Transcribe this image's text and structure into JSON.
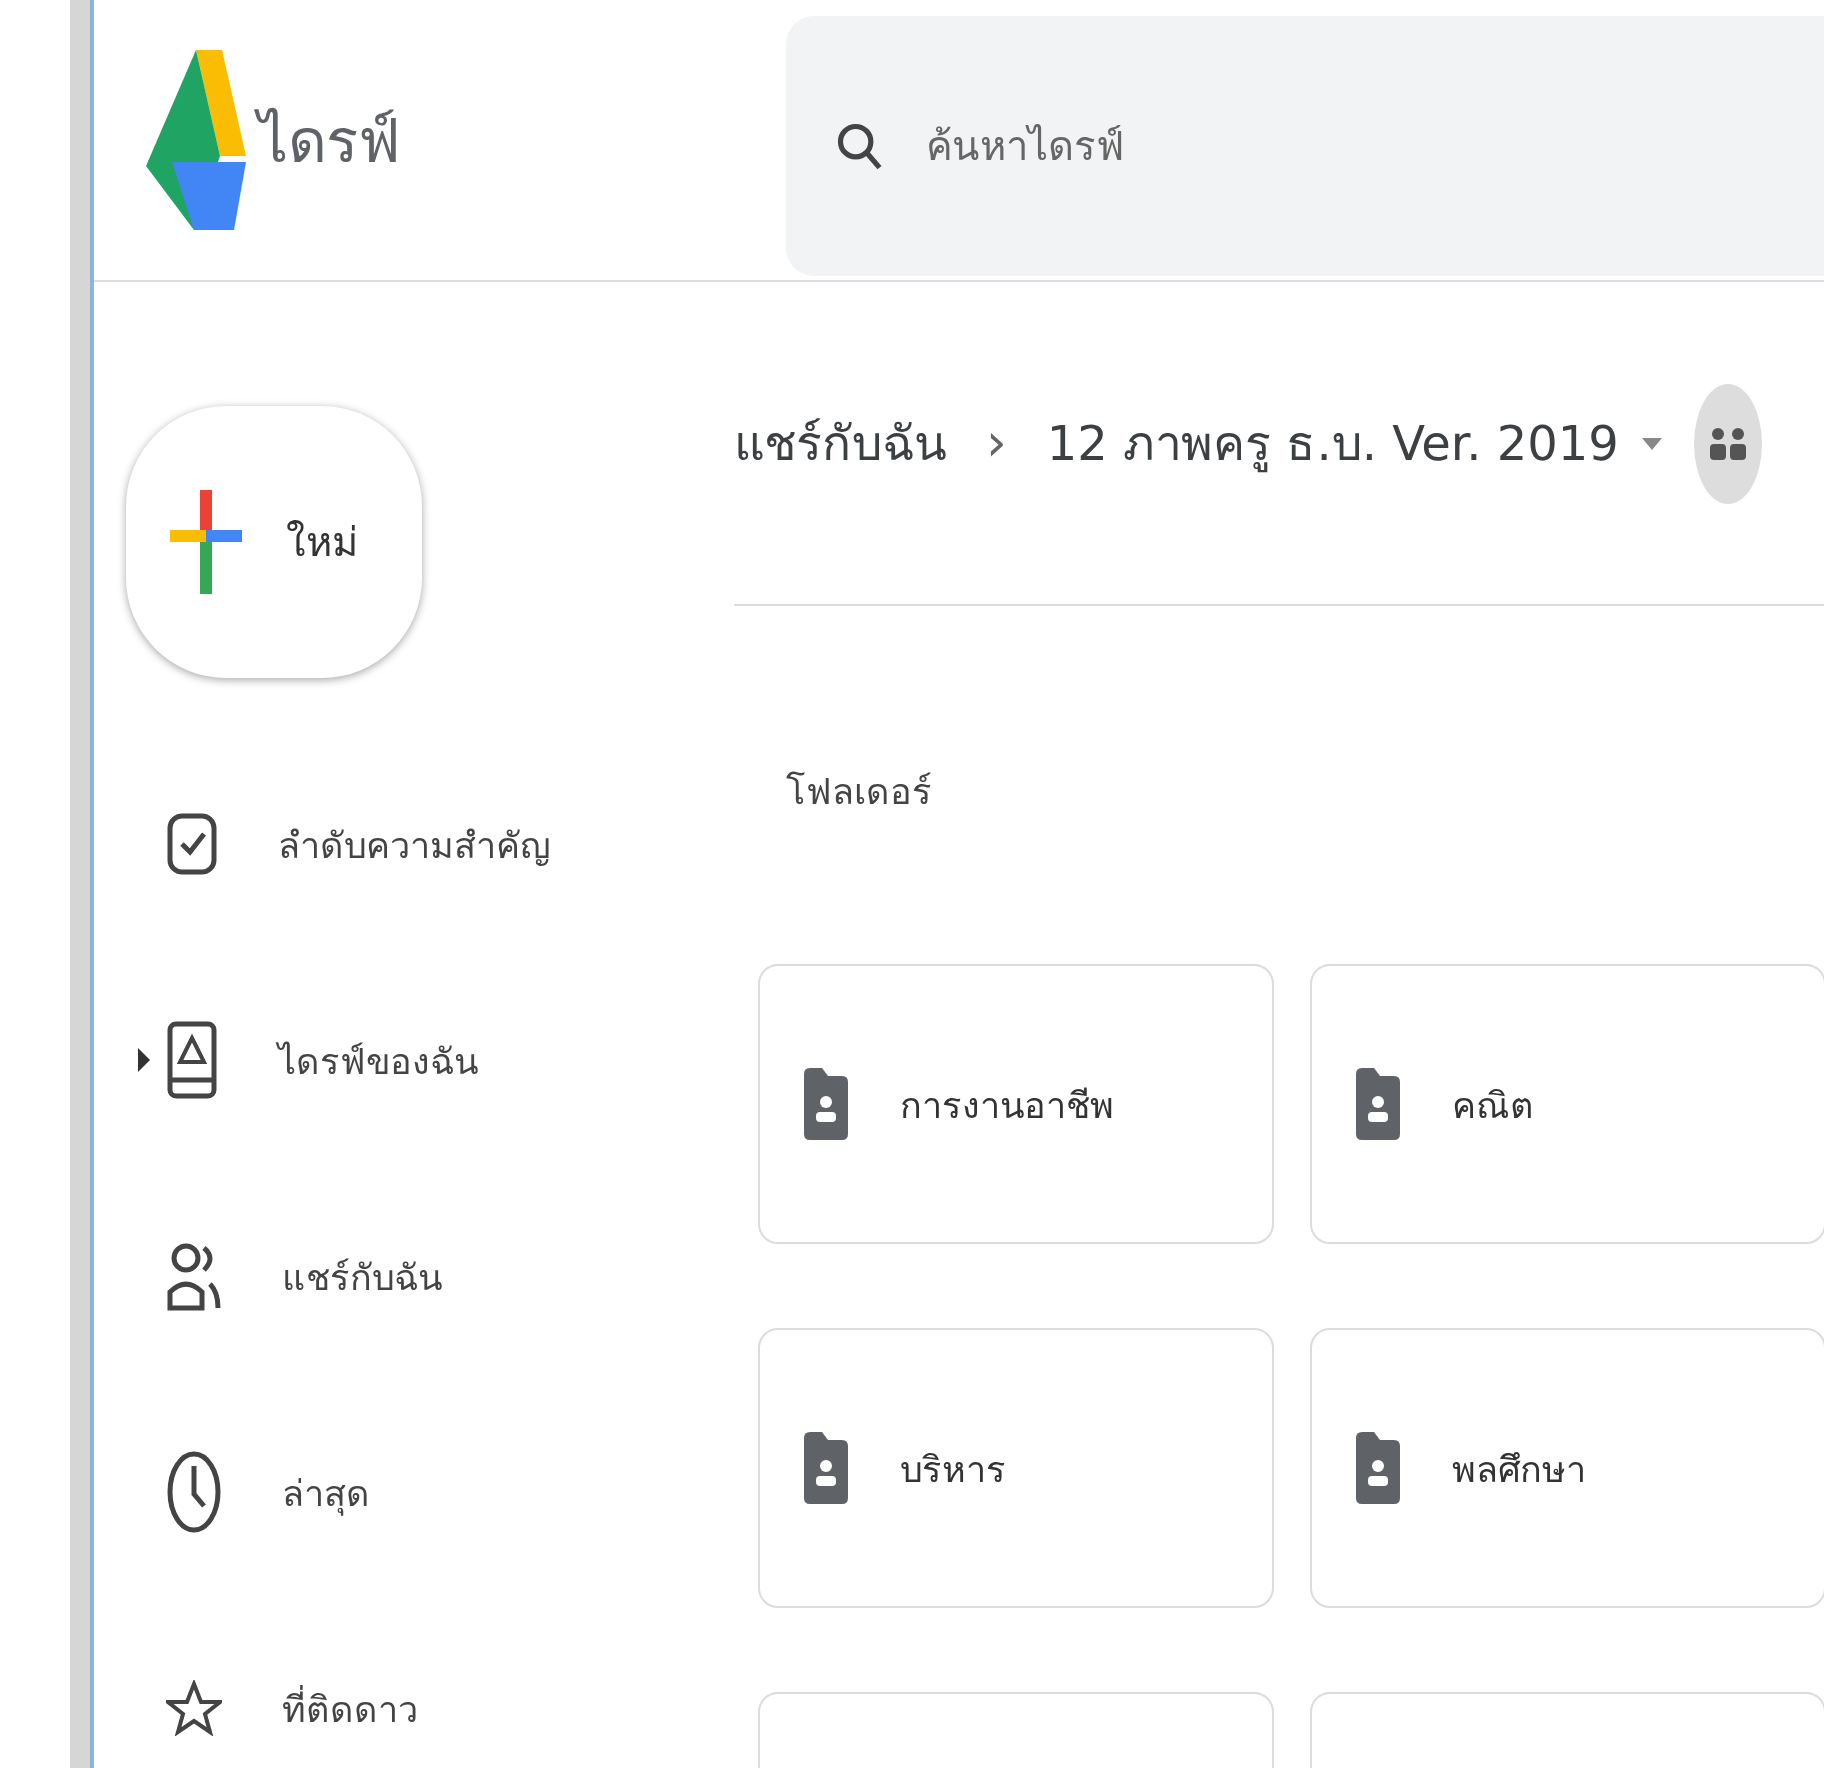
{
  "app": {
    "title": "ไดรฟ์"
  },
  "search": {
    "placeholder": "ค้นหาไดรฟ์"
  },
  "new_button": {
    "label": "ใหม่"
  },
  "sidebar": {
    "items": [
      {
        "kind": "priority",
        "label": "ลำดับความสำคัญ",
        "expandable": false
      },
      {
        "kind": "drive",
        "label": "ไดรฟ์ของฉัน",
        "expandable": true
      },
      {
        "kind": "shared",
        "label": "แชร์กับฉัน",
        "expandable": false
      },
      {
        "kind": "recent",
        "label": "ล่าสุด",
        "expandable": false
      },
      {
        "kind": "starred",
        "label": "ที่ติดดาว",
        "expandable": false
      }
    ]
  },
  "breadcrumb": {
    "root": "แชร์กับฉัน",
    "separator": "›",
    "current": "12 ภาพครู ธ.บ. Ver. 2019"
  },
  "section_title": "โฟลเดอร์",
  "folders": [
    {
      "kind": "folder",
      "name": "การงานอาชีพ"
    },
    {
      "kind": "folder",
      "name": "คณิต"
    },
    {
      "kind": "folder",
      "name": "บริหาร"
    },
    {
      "kind": "folder",
      "name": "พลศึกษา"
    },
    {
      "kind": "cut_off"
    },
    {
      "kind": "cut_off"
    }
  ]
}
